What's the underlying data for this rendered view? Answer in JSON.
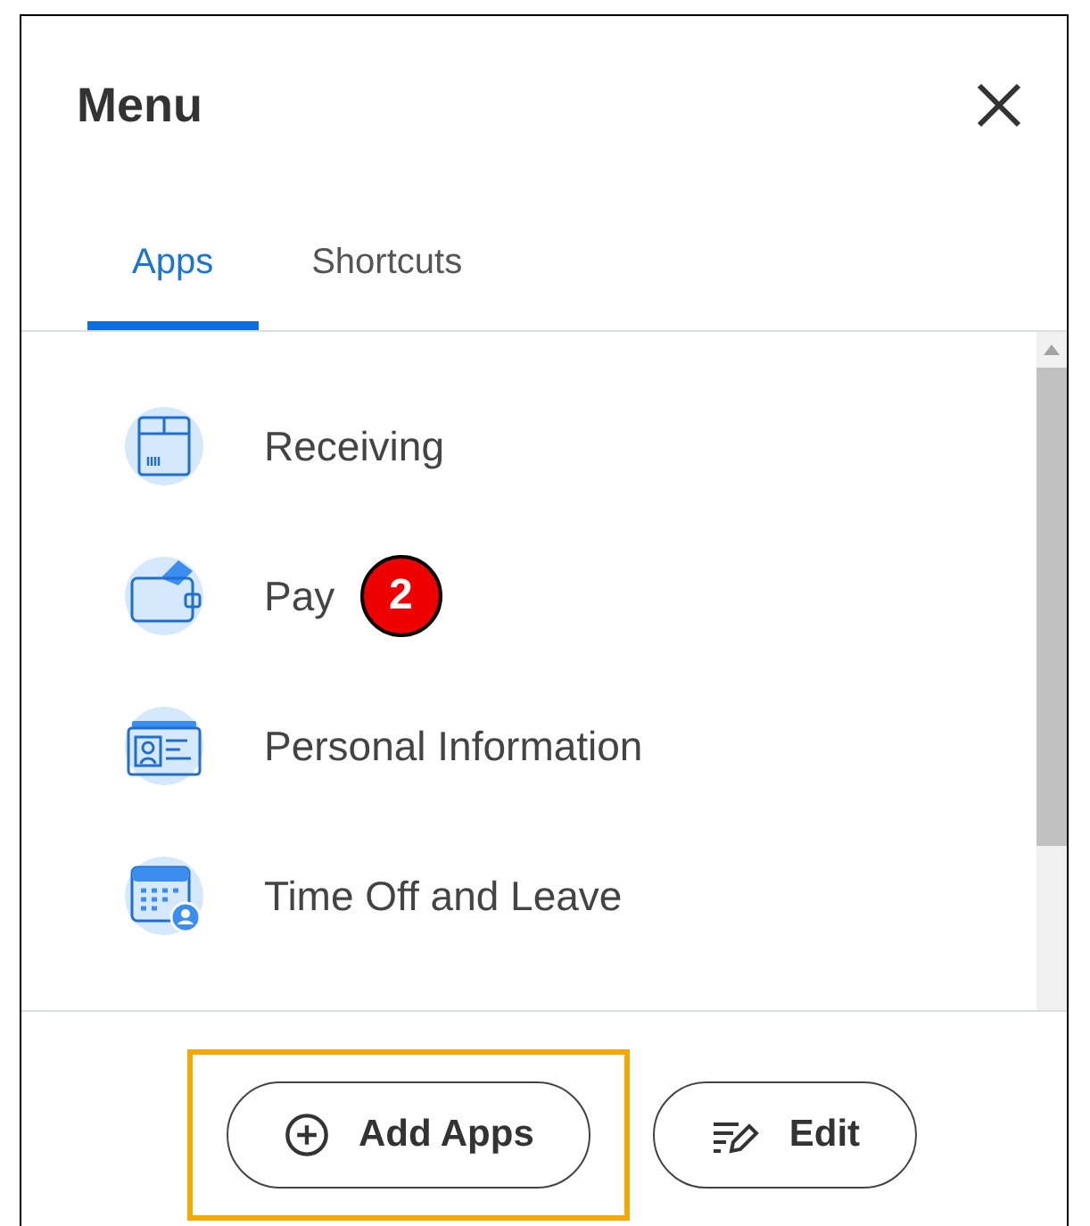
{
  "menu": {
    "title": "Menu"
  },
  "tabs": [
    {
      "label": "Apps",
      "selected": true
    },
    {
      "label": "Shortcuts",
      "selected": false
    }
  ],
  "apps": [
    {
      "kind": "box",
      "label": "Receiving"
    },
    {
      "kind": "wallet",
      "label": "Pay",
      "badge": "2"
    },
    {
      "kind": "card",
      "label": "Personal Information"
    },
    {
      "kind": "calendar",
      "label": "Time Off and Leave"
    }
  ],
  "buttons": [
    {
      "kind": "add",
      "label": "Add Apps",
      "highlighted": true
    },
    {
      "kind": "edit",
      "label": "Edit",
      "highlighted": false
    }
  ]
}
